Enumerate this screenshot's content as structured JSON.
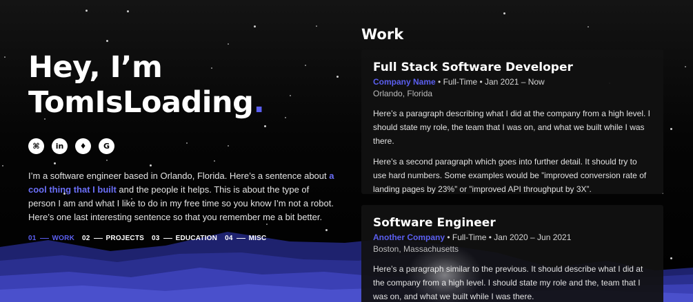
{
  "hero": {
    "line1": "Hey, I’m",
    "line2": "TomIsLoading",
    "dot": "."
  },
  "socials": [
    {
      "icon": "github-icon",
      "glyph": "⌘"
    },
    {
      "icon": "linkedin-icon",
      "glyph": "in"
    },
    {
      "icon": "twitter-icon",
      "glyph": "♦"
    },
    {
      "icon": "google-icon",
      "glyph": "G"
    }
  ],
  "bio": {
    "part1": "I’m a software engineer based in Orlando, Florida. Here’s a sentence about ",
    "link": "a cool thing that I built",
    "part2": " and the people it helps. This is about the type of person I am and what I like to do in my free time so you know I’m not a robot. Here’s one last interesting sentence so that you remember me a bit better."
  },
  "nav": [
    {
      "num": "01",
      "label": "WORK",
      "active": true
    },
    {
      "num": "02",
      "label": "PROJECTS",
      "active": false
    },
    {
      "num": "03",
      "label": "EDUCATION",
      "active": false
    },
    {
      "num": "04",
      "label": "MISC",
      "active": false
    }
  ],
  "work": {
    "title": "Work",
    "jobs": [
      {
        "title": "Full Stack Software Developer",
        "company": "Company Name",
        "details": " • Full-Time • Jan 2021 – Now",
        "location": "Orlando, Florida",
        "paragraphs": [
          "Here’s a paragraph describing what I did at the company from a high level. I should state my role, the team that I was on, and what we built while I was there.",
          "Here’s a second paragraph which goes into further detail. It should try to use hard numbers. Some examples would be ”improved conversion rate of landing pages by 23%” or ”improved API throughput by 3X”."
        ]
      },
      {
        "title": "Software Engineer",
        "company": "Another Company",
        "details": " • Full-Time • Jan 2020 – Jun 2021",
        "location": "Boston, Massachusetts",
        "paragraphs": [
          "Here’s a paragraph similar to the previous. It should describe what I did at the company from a high level. I should state my role and the, team that I was on, and what we built while I was there."
        ]
      }
    ]
  },
  "colors": {
    "accent": "#5b5ff0",
    "background": "#000000",
    "card": "#111111",
    "mountain_dark": "#2a2f8f",
    "mountain_light": "#3b40b5"
  }
}
